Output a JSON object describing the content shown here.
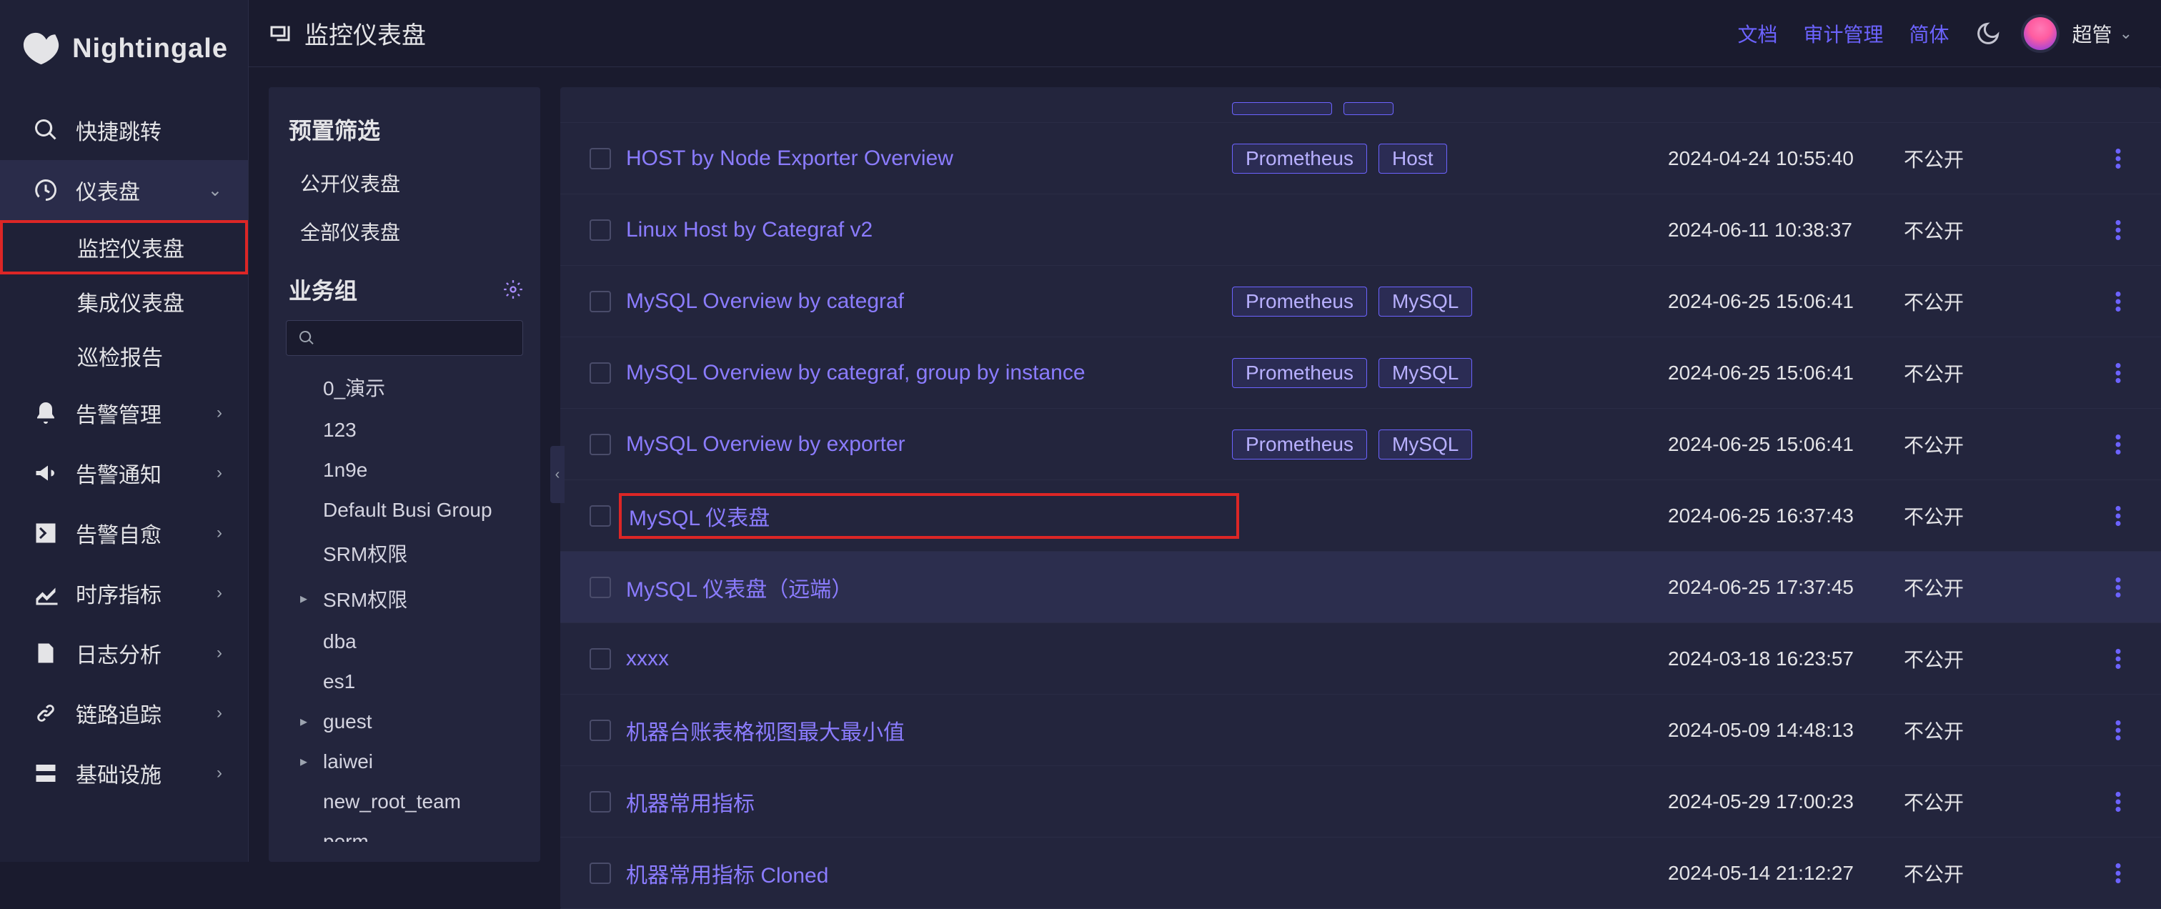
{
  "app": {
    "name": "Nightingale"
  },
  "header": {
    "title": "监控仪表盘",
    "links": {
      "docs": "文档",
      "audit": "审计管理",
      "lang": "简体"
    },
    "user": "超管"
  },
  "sidebar": {
    "items": [
      {
        "key": "quickjump",
        "label": "快捷跳转",
        "icon": "search"
      },
      {
        "key": "dashboards",
        "label": "仪表盘",
        "icon": "dashboard",
        "expanded": true,
        "children": [
          {
            "key": "monitor-dash",
            "label": "监控仪表盘",
            "highlighted": true
          },
          {
            "key": "integrated-dash",
            "label": "集成仪表盘"
          },
          {
            "key": "inspection-report",
            "label": "巡检报告"
          }
        ]
      },
      {
        "key": "alert-manage",
        "label": "告警管理",
        "icon": "bell"
      },
      {
        "key": "alert-notify",
        "label": "告警通知",
        "icon": "megaphone"
      },
      {
        "key": "alert-selfheal",
        "label": "告警自愈",
        "icon": "terminal"
      },
      {
        "key": "ts-metrics",
        "label": "时序指标",
        "icon": "chart"
      },
      {
        "key": "log-analysis",
        "label": "日志分析",
        "icon": "log"
      },
      {
        "key": "trace",
        "label": "链路追踪",
        "icon": "link"
      },
      {
        "key": "infra",
        "label": "基础设施",
        "icon": "server"
      }
    ]
  },
  "filter": {
    "preset_heading": "预置筛选",
    "preset_items": [
      {
        "key": "public",
        "label": "公开仪表盘"
      },
      {
        "key": "all",
        "label": "全部仪表盘"
      }
    ],
    "biz_heading": "业务组",
    "biz_items": [
      {
        "label": "0_演示"
      },
      {
        "label": "123"
      },
      {
        "label": "1n9e"
      },
      {
        "label": "Default Busi Group"
      },
      {
        "label": "SRM权限"
      },
      {
        "label": "SRM权限",
        "expandable": true
      },
      {
        "label": "dba"
      },
      {
        "label": "es1"
      },
      {
        "label": "guest",
        "expandable": true
      },
      {
        "label": "laiwei",
        "expandable": true
      },
      {
        "label": "new_root_team"
      },
      {
        "label": "perm"
      }
    ]
  },
  "table": {
    "public_no": "不公开",
    "rows": [
      {
        "name": "HOST by Node Exporter Overview",
        "tags": [
          "Prometheus",
          "Host"
        ],
        "time": "2024-04-24 10:55:40",
        "public": "不公开"
      },
      {
        "name": "Linux Host by Categraf v2",
        "tags": [],
        "time": "2024-06-11 10:38:37",
        "public": "不公开"
      },
      {
        "name": "MySQL Overview by categraf",
        "tags": [
          "Prometheus",
          "MySQL"
        ],
        "time": "2024-06-25 15:06:41",
        "public": "不公开"
      },
      {
        "name": "MySQL Overview by categraf, group by instance",
        "tags": [
          "Prometheus",
          "MySQL"
        ],
        "time": "2024-06-25 15:06:41",
        "public": "不公开"
      },
      {
        "name": "MySQL Overview by exporter",
        "tags": [
          "Prometheus",
          "MySQL"
        ],
        "time": "2024-06-25 15:06:41",
        "public": "不公开"
      },
      {
        "name": "MySQL 仪表盘",
        "tags": [],
        "time": "2024-06-25 16:37:43",
        "public": "不公开",
        "highlighted": true
      },
      {
        "name": "MySQL 仪表盘（远端）",
        "tags": [],
        "time": "2024-06-25 17:37:45",
        "public": "不公开",
        "hover": true
      },
      {
        "name": "xxxx",
        "tags": [],
        "time": "2024-03-18 16:23:57",
        "public": "不公开"
      },
      {
        "name": "机器台账表格视图最大最小值",
        "tags": [],
        "time": "2024-05-09 14:48:13",
        "public": "不公开"
      },
      {
        "name": "机器常用指标",
        "tags": [],
        "time": "2024-05-29 17:00:23",
        "public": "不公开"
      },
      {
        "name": "机器常用指标 Cloned",
        "tags": [],
        "time": "2024-05-14 21:12:27",
        "public": "不公开"
      }
    ]
  }
}
